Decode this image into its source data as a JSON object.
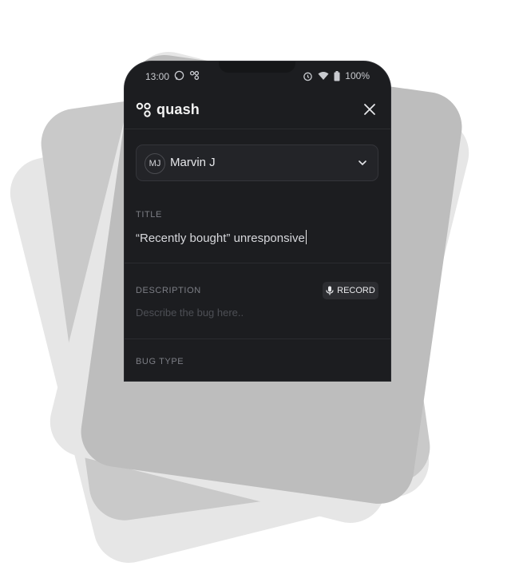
{
  "status_bar": {
    "time": "13:00",
    "battery": "100%"
  },
  "header": {
    "logo_text": "quash"
  },
  "reporter": {
    "initials": "MJ",
    "name": "Marvin J"
  },
  "title_field": {
    "label": "TITLE",
    "value": "“Recently bought” unresponsive"
  },
  "description_field": {
    "label": "DESCRIPTION",
    "record_label": "RECORD",
    "placeholder": "Describe the bug here.."
  },
  "bug_type_field": {
    "label": "BUG TYPE"
  },
  "colors": {
    "phone_bg": "#1c1d20",
    "page_bg": "#ffffff",
    "text_primary": "#e6e7ea",
    "text_muted": "#7c7e85"
  }
}
